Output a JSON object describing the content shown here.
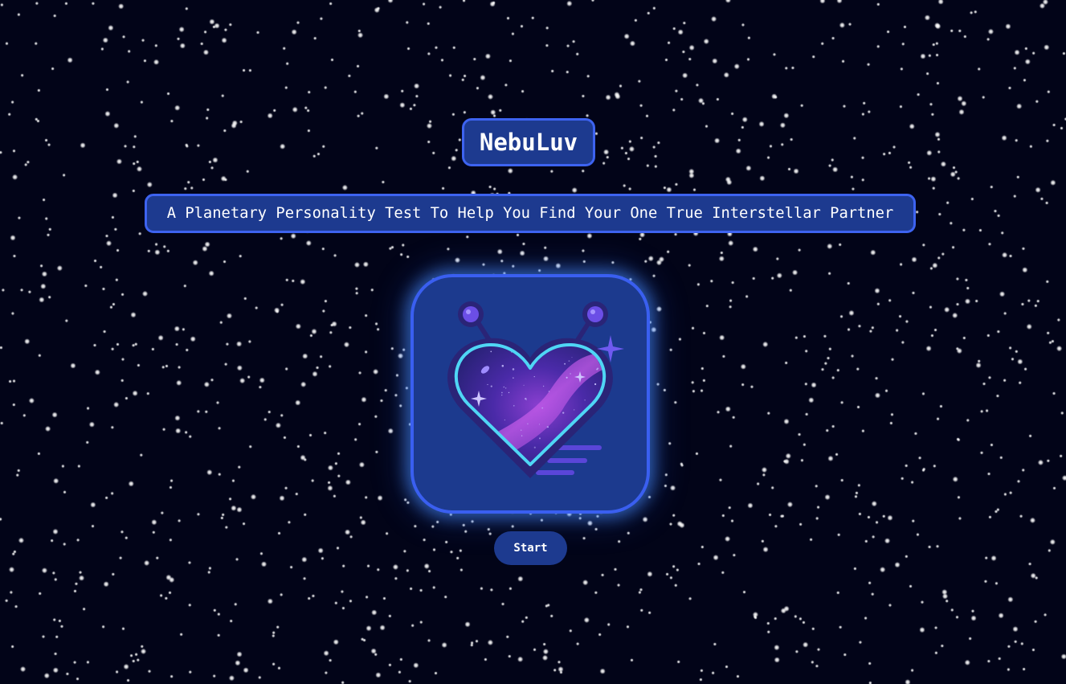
{
  "app": {
    "title": "NebuLuv",
    "subtitle": "A Planetary Personality Test To Help You Find Your One True Interstellar Partner"
  },
  "logo": {
    "icon": "alien-heart-nebula-icon"
  },
  "actions": {
    "start_label": "Start"
  },
  "colors": {
    "background": "#020418",
    "panel": "#1d3a8f",
    "panel_border": "#3d63f0",
    "heart_outline": "#4fd6f5",
    "nebula_purple": "#7a32c8"
  }
}
